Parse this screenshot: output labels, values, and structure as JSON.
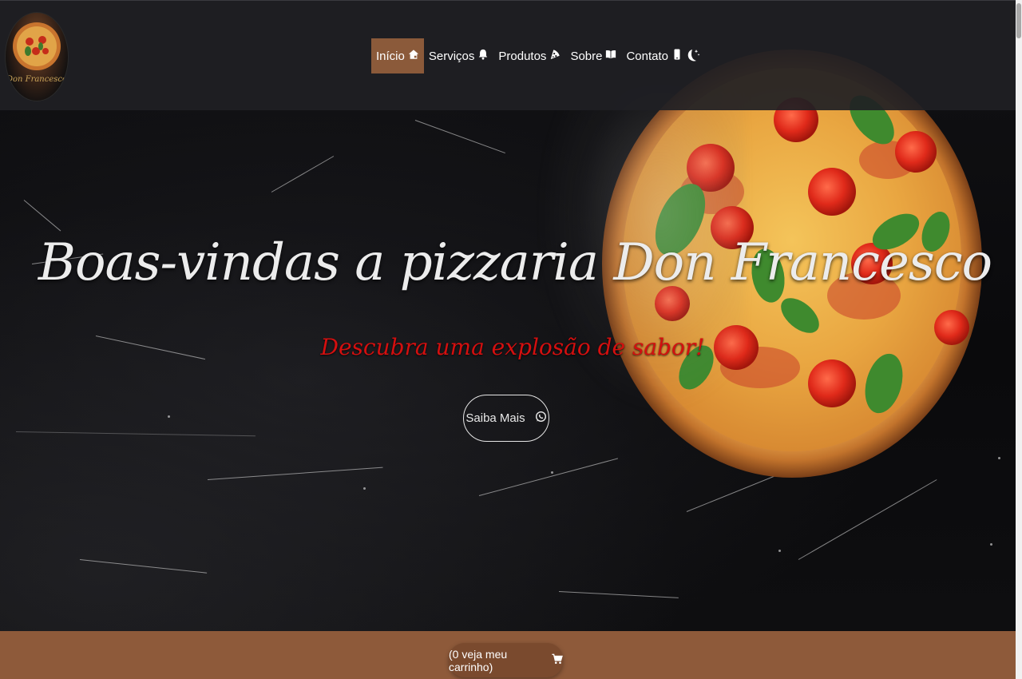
{
  "header": {
    "logo": {
      "alt_text": "Don Francesco",
      "icon": "pizza-logo"
    },
    "nav": [
      {
        "label": "Início",
        "icon": "home-icon",
        "active": true
      },
      {
        "label": "Serviços",
        "icon": "bell-icon",
        "active": false
      },
      {
        "label": "Produtos",
        "icon": "pizza-slice-icon",
        "active": false
      },
      {
        "label": "Sobre",
        "icon": "book-icon",
        "active": false
      },
      {
        "label": "Contato",
        "icon": "phone-icon",
        "active": false
      }
    ],
    "theme_toggle_icon": "moon-stars-icon"
  },
  "hero": {
    "title": "Boas-vindas a pizzaria Don Francesco",
    "subtitle": "Descubra uma explosão de sabor!",
    "cta_label": "Saiba Mais",
    "cta_icon": "whatsapp-icon"
  },
  "cart": {
    "label": "(0 veja meu carrinho)",
    "icon": "cart-icon"
  },
  "colors": {
    "accent": "#8e5a3a",
    "nav_active": "#8b5a3a",
    "subtitle": "#d40f0f",
    "header_bg": "#202024"
  }
}
